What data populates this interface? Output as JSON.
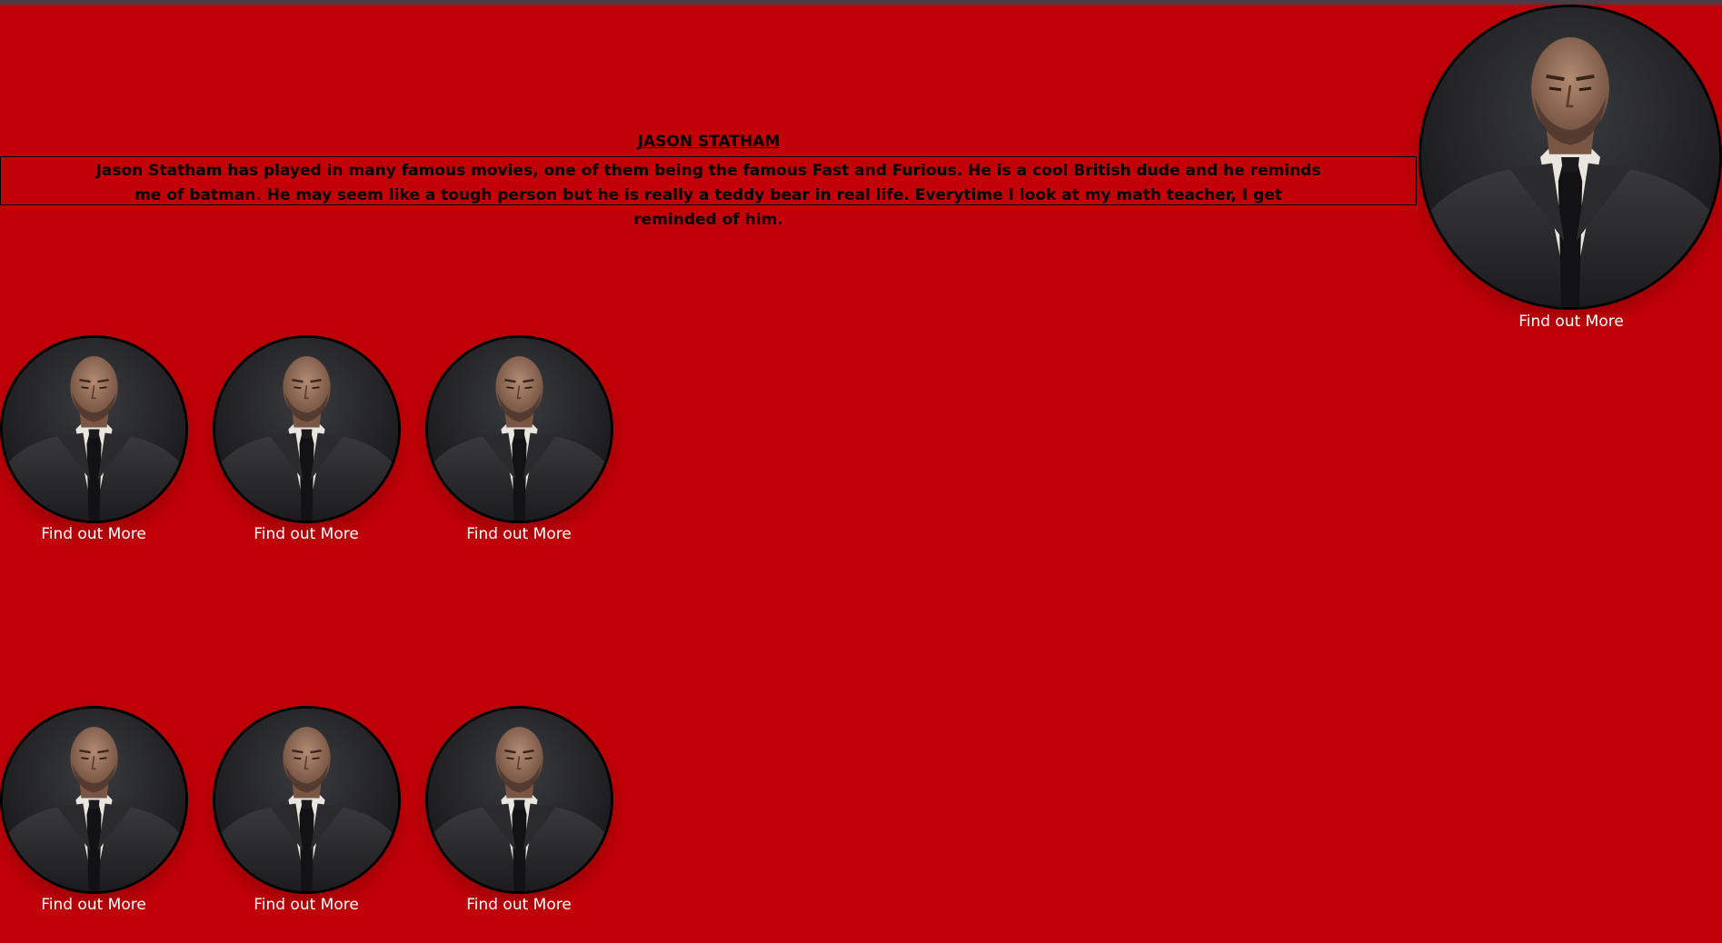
{
  "page": {
    "background": "#c10008",
    "title": "JASON STATHAM",
    "bio": "Jason Statham has played in many famous movies, one of them being the famous Fast and Furious. He is a cool British dude and he reminds me of batman. He may seem like a tough person but he is really a teddy bear in real life. Everytime I look at my math teacher, I get reminded of him."
  },
  "hero": {
    "link_label": "Find out More"
  },
  "grid": {
    "items": [
      {
        "link_label": "Find out More"
      },
      {
        "link_label": "Find out More"
      },
      {
        "link_label": "Find out More"
      },
      {
        "link_label": "Find out More"
      },
      {
        "link_label": "Find out More"
      },
      {
        "link_label": "Find out More"
      }
    ]
  }
}
